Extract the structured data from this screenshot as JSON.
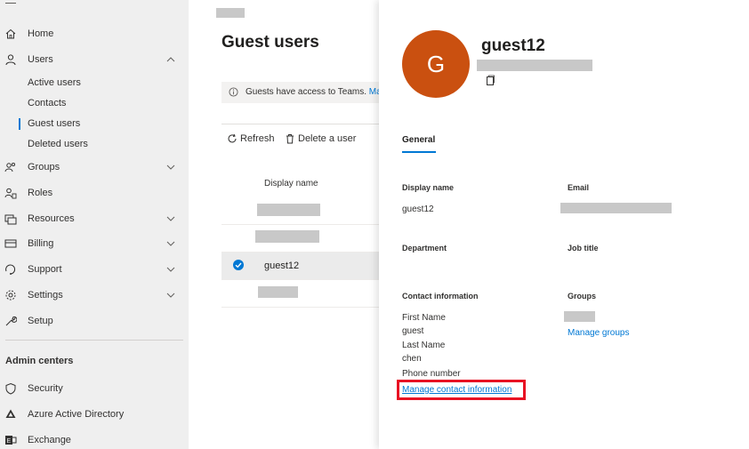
{
  "sidebar": {
    "items": [
      {
        "label": "Home",
        "icon": "home-icon"
      },
      {
        "label": "Users",
        "icon": "user-icon",
        "expanded": true
      },
      {
        "label": "Groups",
        "icon": "groups-icon"
      },
      {
        "label": "Roles",
        "icon": "roles-icon"
      },
      {
        "label": "Resources",
        "icon": "resources-icon"
      },
      {
        "label": "Billing",
        "icon": "billing-icon"
      },
      {
        "label": "Support",
        "icon": "support-icon"
      },
      {
        "label": "Settings",
        "icon": "gear-icon"
      },
      {
        "label": "Setup",
        "icon": "wrench-icon"
      }
    ],
    "users_sub": [
      {
        "label": "Active users"
      },
      {
        "label": "Contacts"
      },
      {
        "label": "Guest users",
        "active": true
      },
      {
        "label": "Deleted users"
      }
    ],
    "admin_centers_heading": "Admin centers",
    "admin_centers": [
      {
        "label": "Security",
        "icon": "shield-icon"
      },
      {
        "label": "Azure Active Directory",
        "icon": "azure-ad-icon"
      },
      {
        "label": "Exchange",
        "icon": "exchange-icon"
      }
    ]
  },
  "main": {
    "title": "Guest users",
    "banner_text": "Guests have access to Teams.",
    "banner_link": "Manag",
    "commands": {
      "refresh": "Refresh",
      "delete": "Delete a user"
    },
    "column_display_name": "Display name",
    "selected_row_name": "guest12"
  },
  "panel": {
    "avatar_initial": "G",
    "user_name": "guest12",
    "tab_general": "General",
    "display_name_label": "Display name",
    "display_name_value": "guest12",
    "email_label": "Email",
    "department_label": "Department",
    "job_title_label": "Job title",
    "contact_info_label": "Contact information",
    "first_name_label": "First Name",
    "first_name_value": "guest",
    "last_name_label": "Last Name",
    "last_name_value": "chen",
    "phone_label": "Phone number",
    "manage_contact_link": "Manage contact information",
    "groups_label": "Groups",
    "manage_groups_link": "Manage groups"
  },
  "colors": {
    "accent": "#0078d4",
    "avatar": "#ca5010",
    "highlight": "#e81123"
  }
}
